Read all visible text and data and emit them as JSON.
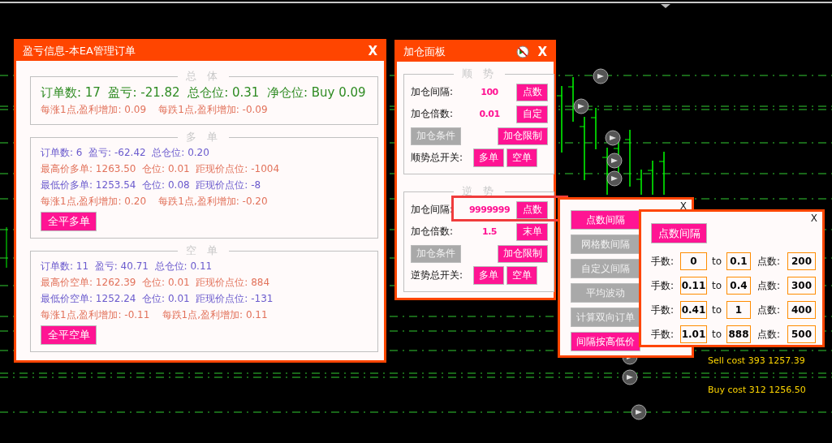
{
  "chart": {
    "labels": [
      {
        "text": "Sell cost 393 1257.39"
      },
      {
        "text": "Buy cost 312 1256.50"
      }
    ]
  },
  "profit_panel": {
    "title": "盈亏信息-本EA管理订单",
    "close": "X",
    "sections": [
      {
        "legend": "总 体",
        "lines": [
          {
            "kind": "headline",
            "color": "#2e8b22",
            "text": "订单数: 17  盈亏: -21.82  总仓位: 0.31  净仓位: Buy 0.09"
          },
          {
            "kind": "line",
            "color": "#e2725b",
            "text": "每涨1点,盈利增加: 0.09    每跌1点,盈利增加: -0.09"
          }
        ]
      },
      {
        "legend": "多 单",
        "lines": [
          {
            "kind": "line",
            "color": "#6a5acd",
            "text": "订单数: 6  盈亏: -62.42  总仓位: 0.20"
          },
          {
            "kind": "line",
            "color": "#e2725b",
            "text": "最高价多单: 1263.50  仓位: 0.01  距现价点位: -1004"
          },
          {
            "kind": "line",
            "color": "#6a5acd",
            "text": "最低价多单: 1253.54  仓位: 0.08  距现价点位: -8"
          },
          {
            "kind": "line",
            "color": "#e2725b",
            "text": "每涨1点,盈利增加: 0.20    每跌1点,盈利增加: -0.20"
          }
        ],
        "button": "全平多单"
      },
      {
        "legend": "空 单",
        "lines": [
          {
            "kind": "line",
            "color": "#6a5acd",
            "text": "订单数: 11  盈亏: 40.71  总仓位: 0.11"
          },
          {
            "kind": "line",
            "color": "#e2725b",
            "text": "最高价空单: 1262.39  仓位: 0.01  距现价点位: 884"
          },
          {
            "kind": "line",
            "color": "#6a5acd",
            "text": "最低价空单: 1252.24  仓位: 0.01  距现价点位: -131"
          },
          {
            "kind": "line",
            "color": "#e2725b",
            "text": "每涨1点,盈利增加: -0.11    每跌1点,盈利增加: 0.11"
          }
        ],
        "button": "全平空单"
      }
    ]
  },
  "add_panel": {
    "title": "加仓面板",
    "close": "X",
    "sections": [
      {
        "legend": "顺 势",
        "interval_label": "加仓间隔:",
        "interval_value": "100",
        "interval_button": "点数",
        "multiplier_label": "加仓倍数:",
        "multiplier_value": "0.01",
        "multiplier_button": "自定",
        "condition_button": {
          "label": "加仓条件",
          "on": false
        },
        "limit_button": {
          "label": "加仓限制",
          "on": true
        },
        "switch_label": "顺势总开关:",
        "switch_buttons": [
          {
            "label": "多单",
            "on": true
          },
          {
            "label": "空单",
            "on": true
          }
        ]
      },
      {
        "legend": "逆 势",
        "interval_label": "加仓间隔:",
        "interval_value": "9999999",
        "interval_button": "点数",
        "multiplier_label": "加仓倍数:",
        "multiplier_value": "1.5",
        "multiplier_button": "末单",
        "condition_button": {
          "label": "加仓条件",
          "on": false
        },
        "limit_button": {
          "label": "加仓限制",
          "on": true
        },
        "switch_label": "逆势总开关:",
        "switch_buttons": [
          {
            "label": "多单",
            "on": true
          },
          {
            "label": "空单",
            "on": true
          }
        ]
      }
    ]
  },
  "mode_menu": {
    "close": "X",
    "items": [
      {
        "label": "点数间隔",
        "selected": true
      },
      {
        "label": "网格数间隔",
        "selected": false
      },
      {
        "label": "自定义间隔",
        "selected": false
      },
      {
        "label": "平均波动",
        "selected": false
      },
      {
        "label": "计算双向订单",
        "selected": false
      },
      {
        "label": "间隔按高低价",
        "selected": true
      }
    ]
  },
  "interval_panel": {
    "close": "X",
    "title_button": "点数间隔",
    "rows": [
      {
        "lots_label": "手数:",
        "from": "0",
        "to_label": "to",
        "to": "0.1",
        "points_label": "点数:",
        "points": "200"
      },
      {
        "lots_label": "手数:",
        "from": "0.11",
        "to_label": "to",
        "to": "0.4",
        "points_label": "点数:",
        "points": "300"
      },
      {
        "lots_label": "手数:",
        "from": "0.41",
        "to_label": "to",
        "to": "1",
        "points_label": "点数:",
        "points": "400"
      },
      {
        "lots_label": "手数:",
        "from": "1.01",
        "to_label": "to",
        "to": "888",
        "points_label": "点数:",
        "points": "500"
      }
    ]
  }
}
